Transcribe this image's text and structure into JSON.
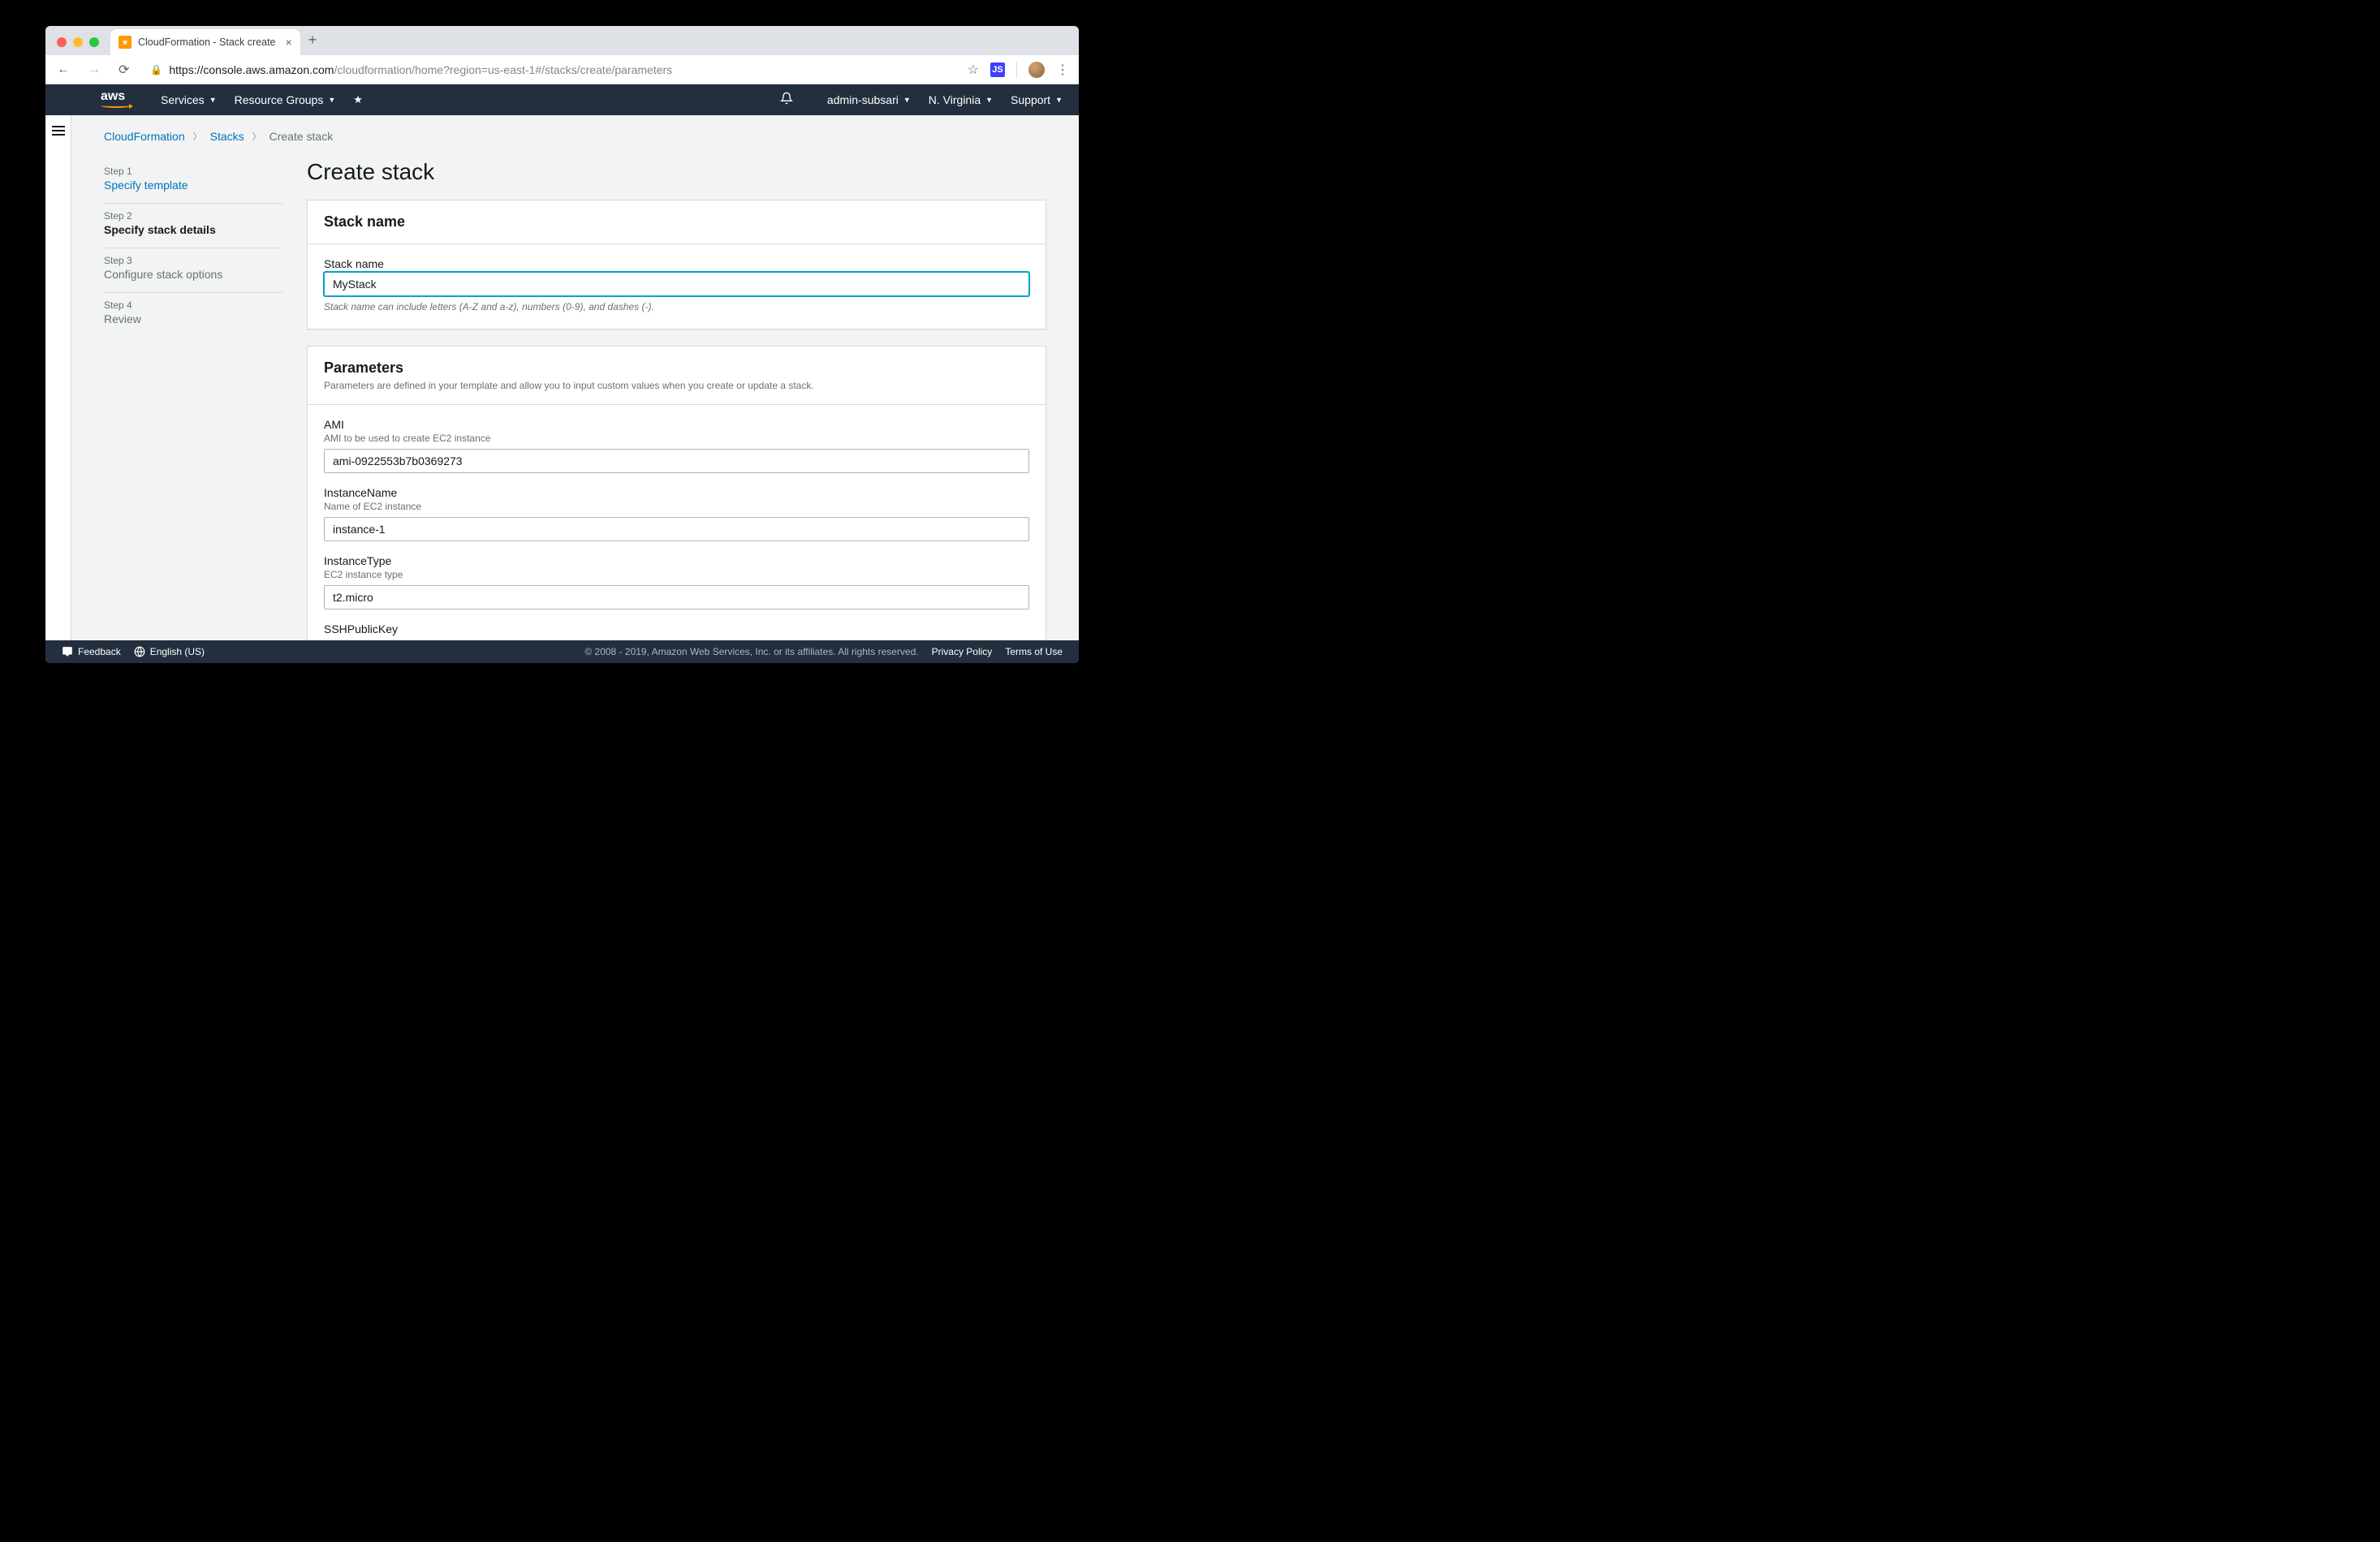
{
  "browser": {
    "tab_title": "CloudFormation - Stack create",
    "url_host": "https://console.aws.amazon.com",
    "url_path": "/cloudformation/home?region=us-east-1#/stacks/create/parameters"
  },
  "header": {
    "logo": "aws",
    "services": "Services",
    "resource_groups": "Resource Groups",
    "user": "admin-subsari",
    "region": "N. Virginia",
    "support": "Support"
  },
  "breadcrumb": {
    "root": "CloudFormation",
    "stacks": "Stacks",
    "current": "Create stack"
  },
  "steps": [
    {
      "num": "Step 1",
      "name": "Specify template"
    },
    {
      "num": "Step 2",
      "name": "Specify stack details"
    },
    {
      "num": "Step 3",
      "name": "Configure stack options"
    },
    {
      "num": "Step 4",
      "name": "Review"
    }
  ],
  "page_title": "Create stack",
  "stack_panel": {
    "title": "Stack name",
    "label": "Stack name",
    "value": "MyStack",
    "hint": "Stack name can include letters (A-Z and a-z), numbers (0-9), and dashes (-)."
  },
  "params_panel": {
    "title": "Parameters",
    "subtitle": "Parameters are defined in your template and allow you to input custom values when you create or update a stack.",
    "items": [
      {
        "label": "AMI",
        "hint": "AMI to be used to create EC2 instance",
        "value": "ami-0922553b7b0369273"
      },
      {
        "label": "InstanceName",
        "hint": "Name of EC2 instance",
        "value": "instance-1"
      },
      {
        "label": "InstanceType",
        "hint": "EC2 instance type",
        "value": "t2.micro"
      },
      {
        "label": "SSHPublicKey",
        "hint": "",
        "value": ""
      }
    ]
  },
  "footer": {
    "feedback": "Feedback",
    "language": "English (US)",
    "copyright": "© 2008 - 2019, Amazon Web Services, Inc. or its affiliates. All rights reserved.",
    "privacy": "Privacy Policy",
    "terms": "Terms of Use"
  }
}
